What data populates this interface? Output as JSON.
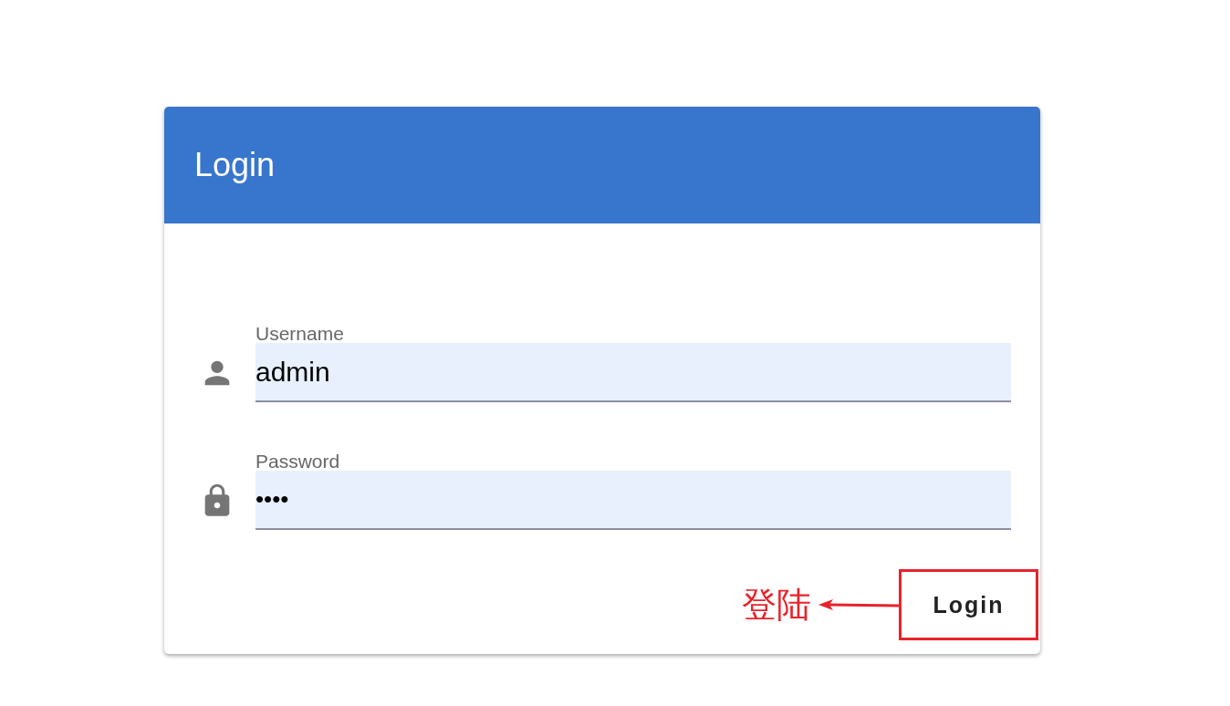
{
  "card": {
    "title": "Login"
  },
  "fields": [
    {
      "kind": "user",
      "label": "Username",
      "value": "admin"
    },
    {
      "kind": "lock",
      "label": "Password",
      "value": "••••"
    }
  ],
  "button": {
    "label": "Login"
  },
  "annotation": {
    "text": "登陆"
  }
}
